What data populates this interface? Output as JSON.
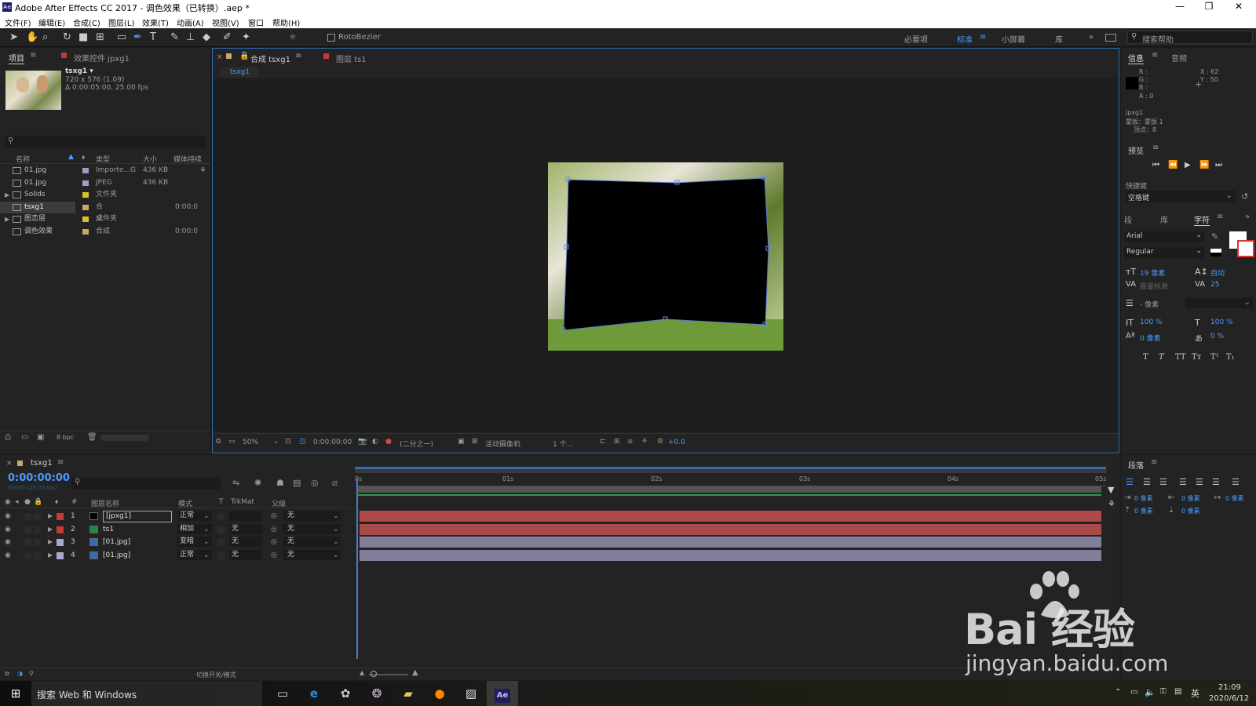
{
  "window": {
    "title": "Adobe After Effects CC 2017 - 调色效果（已转换）.aep *",
    "app_icon": "Ae",
    "minimize": "—",
    "maximize": "❐",
    "close": "✕"
  },
  "menu": [
    "文件(F)",
    "编辑(E)",
    "合成(C)",
    "图层(L)",
    "效果(T)",
    "动画(A)",
    "视图(V)",
    "窗口",
    "帮助(H)"
  ],
  "toolbar": {
    "rotobezier": "RotoBezier",
    "workspaces": [
      "必要项",
      "标准",
      "小屏幕",
      "库"
    ],
    "active_workspace": "标准",
    "search_placeholder": "搜索帮助"
  },
  "project": {
    "tab": "项目",
    "effects_tab": "效果控件 jpxg1",
    "item_name": "tsxg1 ▾",
    "item_size": "720 x 576 (1.09)",
    "item_duration": "Δ 0:00:05:00, 25.00 fps",
    "columns": [
      "名称",
      "类型",
      "大小",
      "媒体持续"
    ],
    "rows": [
      {
        "name": "01.jpg",
        "type": "Importe...G",
        "size": "436 KB",
        "dur": "",
        "color": "#9aa0c8"
      },
      {
        "name": "01.jpg",
        "type": "JPEG",
        "size": "436 KB",
        "dur": "",
        "color": "#9aa0c8"
      },
      {
        "name": "Solids",
        "type": "文件夹",
        "size": "",
        "dur": "",
        "color": "#d9c227"
      },
      {
        "name": "tsxg1",
        "type": "合成",
        "size": "",
        "dur": "0:00:0",
        "color": "#c7a86c"
      },
      {
        "name": "图恋层",
        "type": "文件夹",
        "size": "",
        "dur": "",
        "color": "#d9c227"
      },
      {
        "name": "调色效果",
        "type": "合成",
        "size": "",
        "dur": "0:00:0",
        "color": "#c7a86c"
      }
    ],
    "bpc": "8 bpc"
  },
  "comp": {
    "tab1": "合成 tsxg1",
    "tab2": "图层 ts1",
    "crumb": "tsxg1",
    "zoom": "50%",
    "time": "0:00:00:00",
    "resolution": "(二分之一)",
    "camera": "活动摄像机",
    "views": "1 个...",
    "exposure": "+0.0"
  },
  "info": {
    "tab": "信息",
    "audio_tab": "音频",
    "r": "R :",
    "g": "G :",
    "b": "B :",
    "a": "A : 0",
    "x": "X : 62",
    "y": "Y : 50",
    "layer": "jpxg1",
    "mask": "蒙版：蒙版 1",
    "vertex": "顶点：8"
  },
  "preview": {
    "tab": "预览",
    "shortcut_label": "快捷键",
    "shortcut": "空格键"
  },
  "character": {
    "tab_para": "段",
    "tab_lib": "库",
    "tab_char": "字符",
    "font": "Arial",
    "style": "Regular",
    "size": "19 像素",
    "leading": "自动",
    "kerning": "度量标准",
    "tracking": "25",
    "stroke": "- 像素",
    "vscale": "100 %",
    "hscale": "100 %",
    "baseline": "0 像素",
    "tsume": "0 %"
  },
  "paragraph": {
    "tab": "段落",
    "indent": [
      "0 像素",
      "0 像素",
      "0 像素",
      "0 像素",
      "0 像素"
    ]
  },
  "timeline": {
    "tab": "tsxg1",
    "time": "0:00:00:00",
    "fps": "00000 (25.00 fps)",
    "columns": [
      "图层名称",
      "模式",
      "T",
      "TrkMat",
      "父级"
    ],
    "ruler": [
      "0s",
      "01s",
      "02s",
      "03s",
      "04s",
      "05s"
    ],
    "layers": [
      {
        "n": "1",
        "name": "[jpxg1]",
        "mode": "正常",
        "trk": "",
        "parent": "无",
        "label": "#c43a3a",
        "bar": "#b04a4a"
      },
      {
        "n": "2",
        "name": "ts1",
        "mode": "相加",
        "trk": "无",
        "parent": "无",
        "label": "#c43a3a",
        "bar": "#a84a4a"
      },
      {
        "n": "3",
        "name": "[01.jpg]",
        "mode": "变暗",
        "trk": "无",
        "parent": "无",
        "label": "#a9a8d4",
        "bar": "#807e98"
      },
      {
        "n": "4",
        "name": "[01.jpg]",
        "mode": "正常",
        "trk": "无",
        "parent": "无",
        "label": "#a9a8d4",
        "bar": "#807e98"
      }
    ],
    "toggle": "切换开关/模式"
  },
  "taskbar": {
    "search": "搜索 Web 和 Windows",
    "clock": "21:09",
    "date": "2020/6/12",
    "ime": "英"
  },
  "watermark": {
    "brand": "Bai 经验",
    "url": "jingyan.baidu.com"
  }
}
